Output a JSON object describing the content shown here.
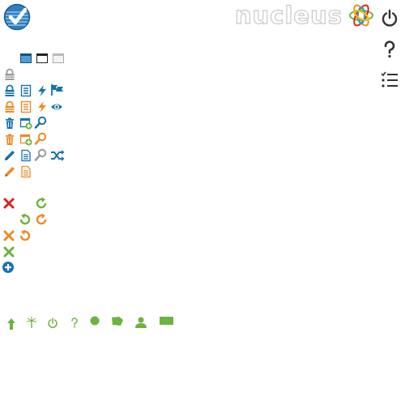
{
  "brand": {
    "name": "nucleus"
  },
  "colors": {
    "blue": "#1673b0",
    "orange": "#f08a24",
    "green": "#6db33f",
    "red": "#d9231f",
    "gray": "#9a9a9a",
    "dark": "#333333"
  },
  "icons": [
    "app-logo-icon",
    "nucleus-logo-icon",
    "power-icon",
    "help-icon",
    "task-list-icon",
    "window-filled-icon",
    "window-outline-icon",
    "window-light-icon",
    "lock-gray-icon",
    "lock-blue-icon",
    "document-list-blue-icon",
    "bolt-blue-icon",
    "flags-blue-icon",
    "lock-orange-icon",
    "document-list-orange-icon",
    "bolt-orange-icon",
    "eye-blue-icon",
    "trash-blue-icon",
    "calendar-add-blue-icon",
    "search-blue-icon",
    "trash-orange-icon",
    "calendar-add-orange-icon",
    "search-orange-icon",
    "pencil-blue-icon",
    "document-blue-icon",
    "search-gray-icon",
    "shuffle-blue-icon",
    "pencil-orange-icon",
    "document-orange-icon",
    "close-red-icon",
    "refresh-green-icon",
    "undo-green-icon",
    "refresh-orange-icon",
    "close-orange-icon",
    "undo-orange-icon",
    "close-green-icon",
    "add-circle-blue-icon",
    "arrow-up-green-icon",
    "antenna-green-icon",
    "power-green-icon",
    "help-green-icon",
    "circle-green-icon",
    "tag-green-icon",
    "user-green-icon",
    "rectangle-green-icon"
  ]
}
